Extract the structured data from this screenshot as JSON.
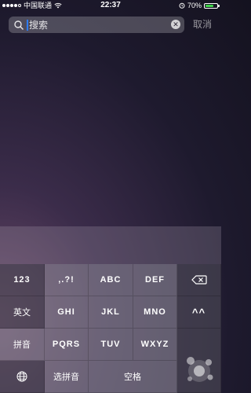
{
  "status_bar": {
    "carrier": "中国联通",
    "time": "22:37",
    "battery_percent": "70%",
    "battery_level": 0.7,
    "battery_color": "#3fd34a"
  },
  "search": {
    "placeholder": "搜索",
    "value": "",
    "cancel_label": "取消",
    "caret_color": "#2d7cf6"
  },
  "keyboard": {
    "row1": [
      "123",
      ",.?!",
      "ABC",
      "DEF",
      "⌫"
    ],
    "row2": [
      "英文",
      "GHI",
      "JKL",
      "MNO",
      "^^"
    ],
    "row3": [
      "拼音",
      "PQRS",
      "TUV",
      "WXYZ"
    ],
    "row4": [
      "🌐",
      "选拼音",
      "空格"
    ]
  }
}
